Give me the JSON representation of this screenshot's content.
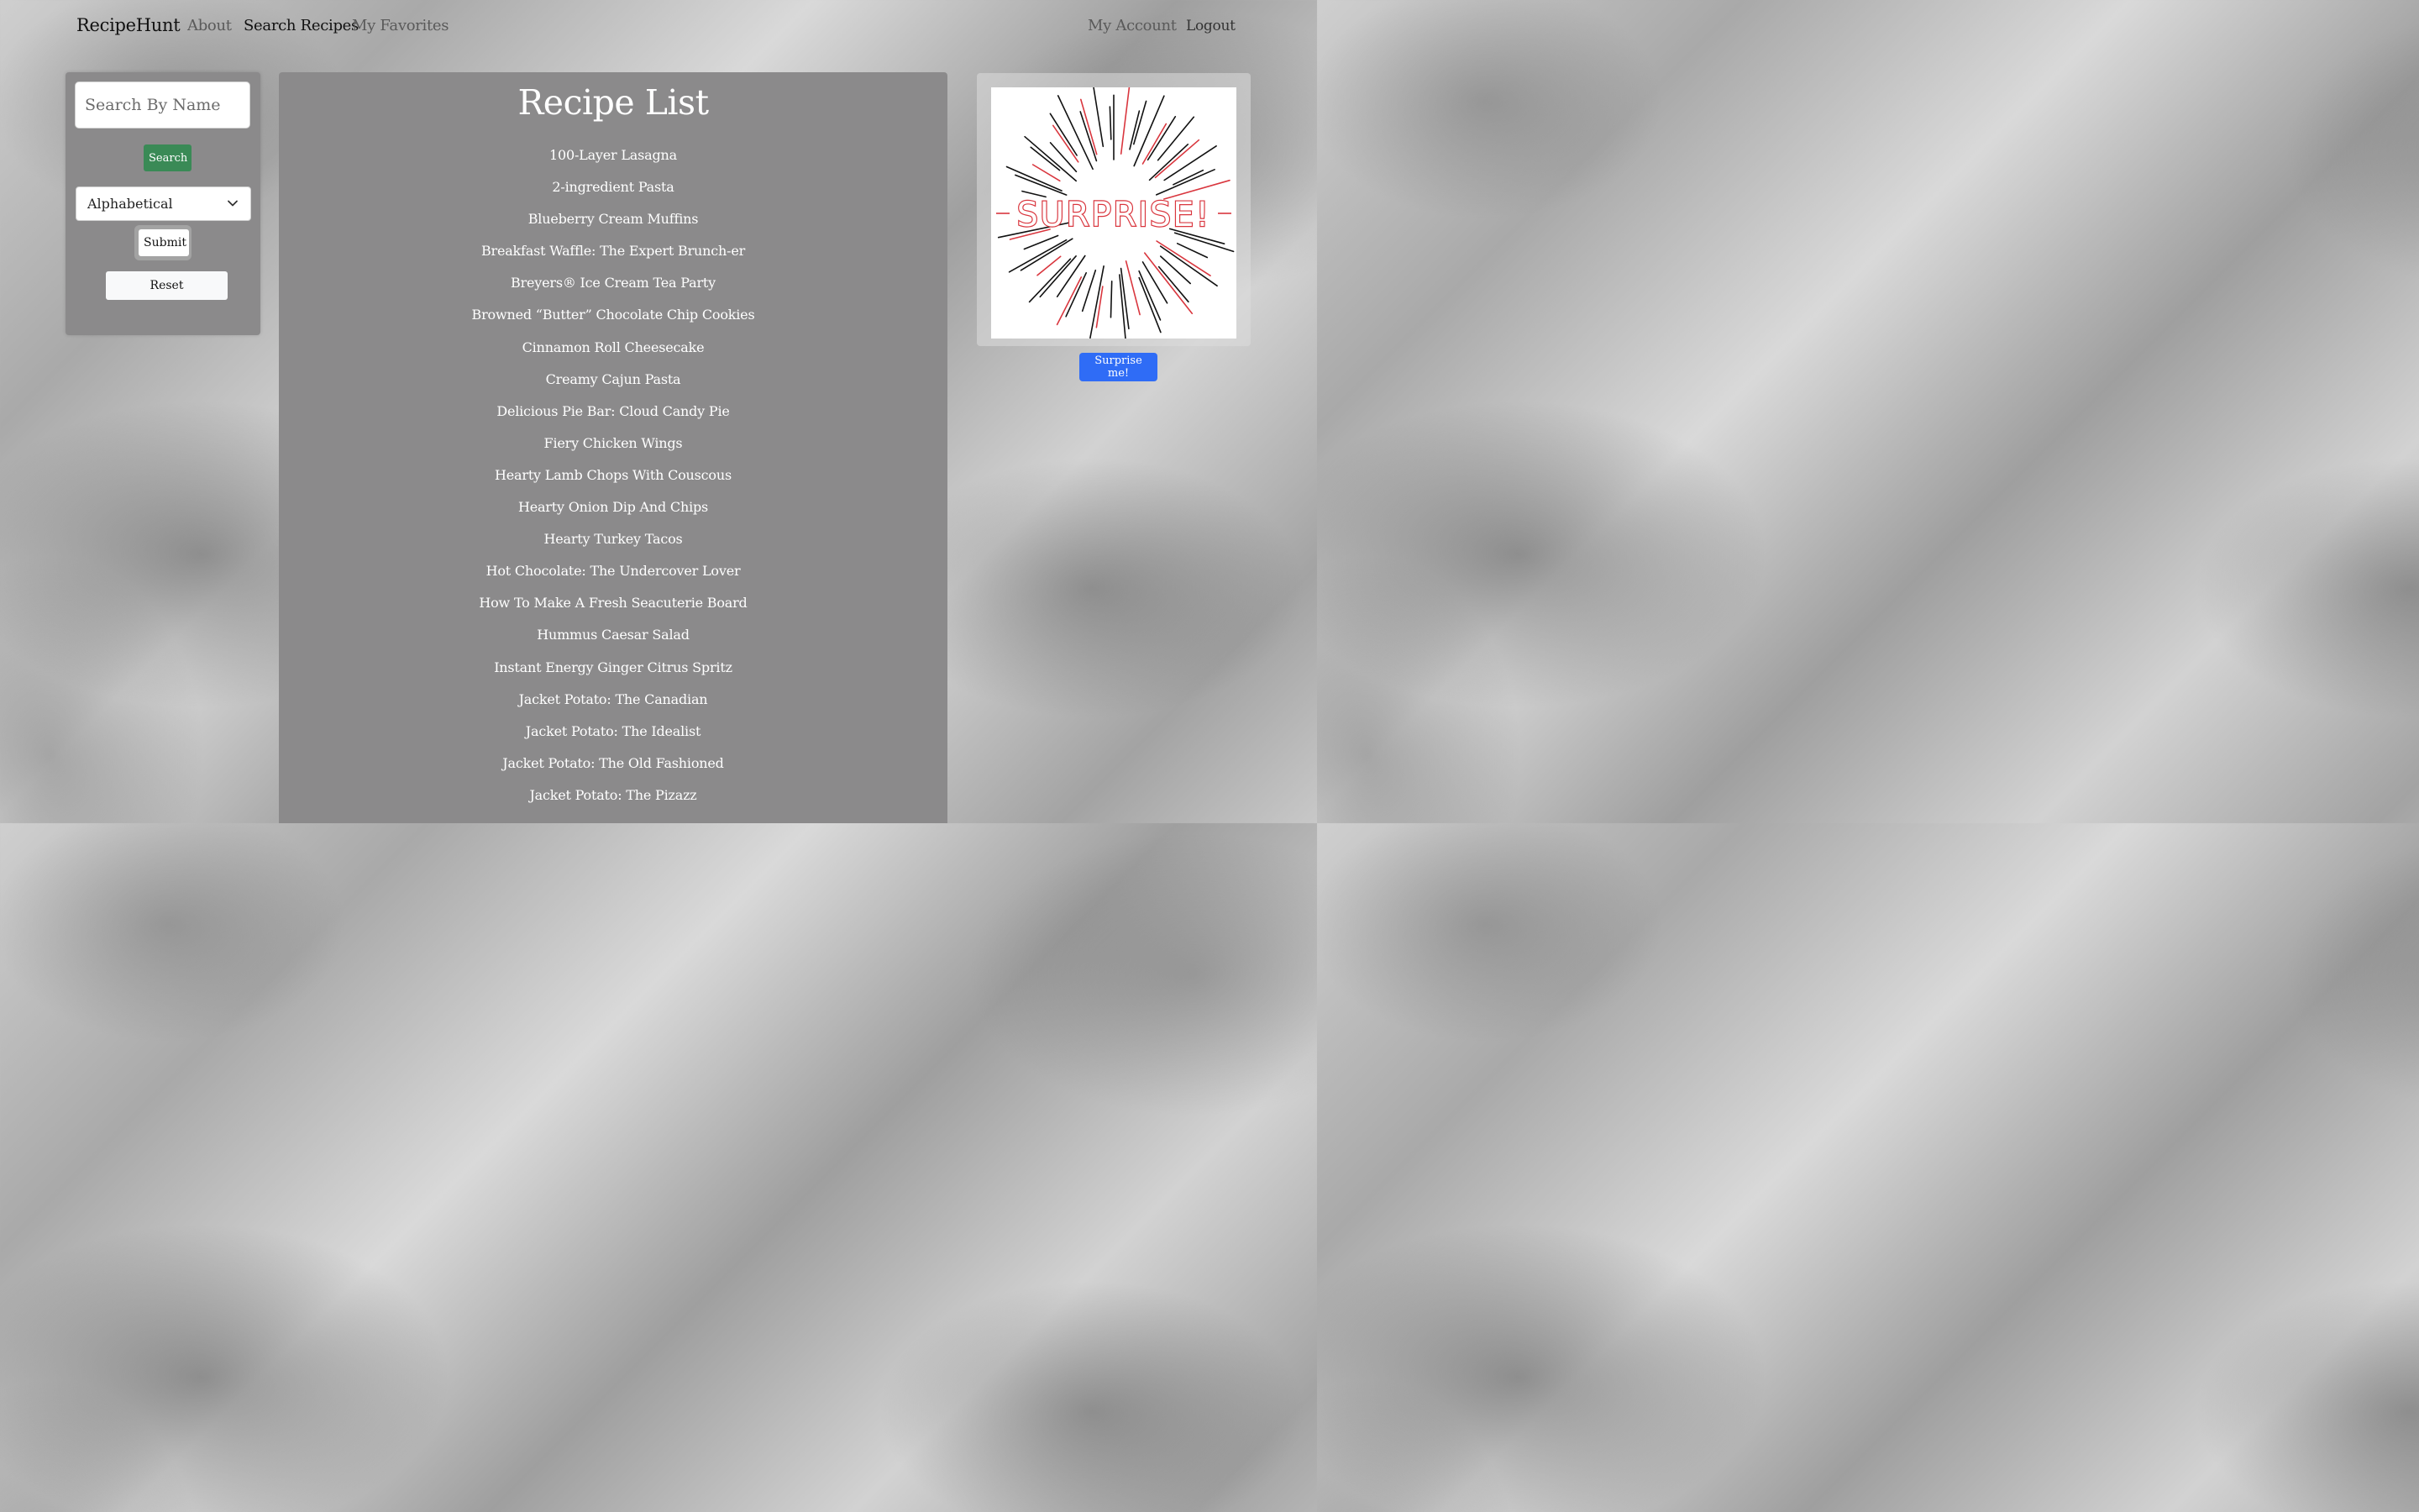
{
  "nav": {
    "brand": "RecipeHunt",
    "links": [
      "About",
      "Search Recipes",
      "My Favorites"
    ],
    "account": "My Account",
    "logout": "Logout"
  },
  "search": {
    "placeholder": "Search By Name",
    "search_label": "Search",
    "sort_value": "Alphabetical",
    "submit_label": "Submit",
    "reset_label": "Reset"
  },
  "main": {
    "title": "Recipe List",
    "recipes": [
      "100-Layer Lasagna",
      "2-ingredient Pasta",
      "Blueberry Cream Muffins",
      "Breakfast Waffle: The Expert Brunch-er",
      "Breyers® Ice Cream Tea Party",
      "Browned “Butter” Chocolate Chip Cookies",
      "Cinnamon Roll Cheesecake",
      "Creamy Cajun Pasta",
      "Delicious Pie Bar: Cloud Candy Pie",
      "Fiery Chicken Wings",
      "Hearty Lamb Chops With Couscous",
      "Hearty Onion Dip And Chips",
      "Hearty Turkey Tacos",
      "Hot Chocolate: The Undercover Lover",
      "How To Make A Fresh Seacuterie Board",
      "Hummus Caesar Salad",
      "Instant Energy Ginger Citrus Spritz",
      "Jacket Potato: The Canadian",
      "Jacket Potato: The Idealist",
      "Jacket Potato: The Old Fashioned",
      "Jacket Potato: The Pizazz"
    ]
  },
  "surprise": {
    "image_text": "SURPRISE!",
    "button_label": "Surprise me!"
  },
  "colors": {
    "panel": "#8b8a8b",
    "search_button": "#3a8a56",
    "surprise_button": "#2f6cf6",
    "surprise_red": "#d9363e"
  }
}
